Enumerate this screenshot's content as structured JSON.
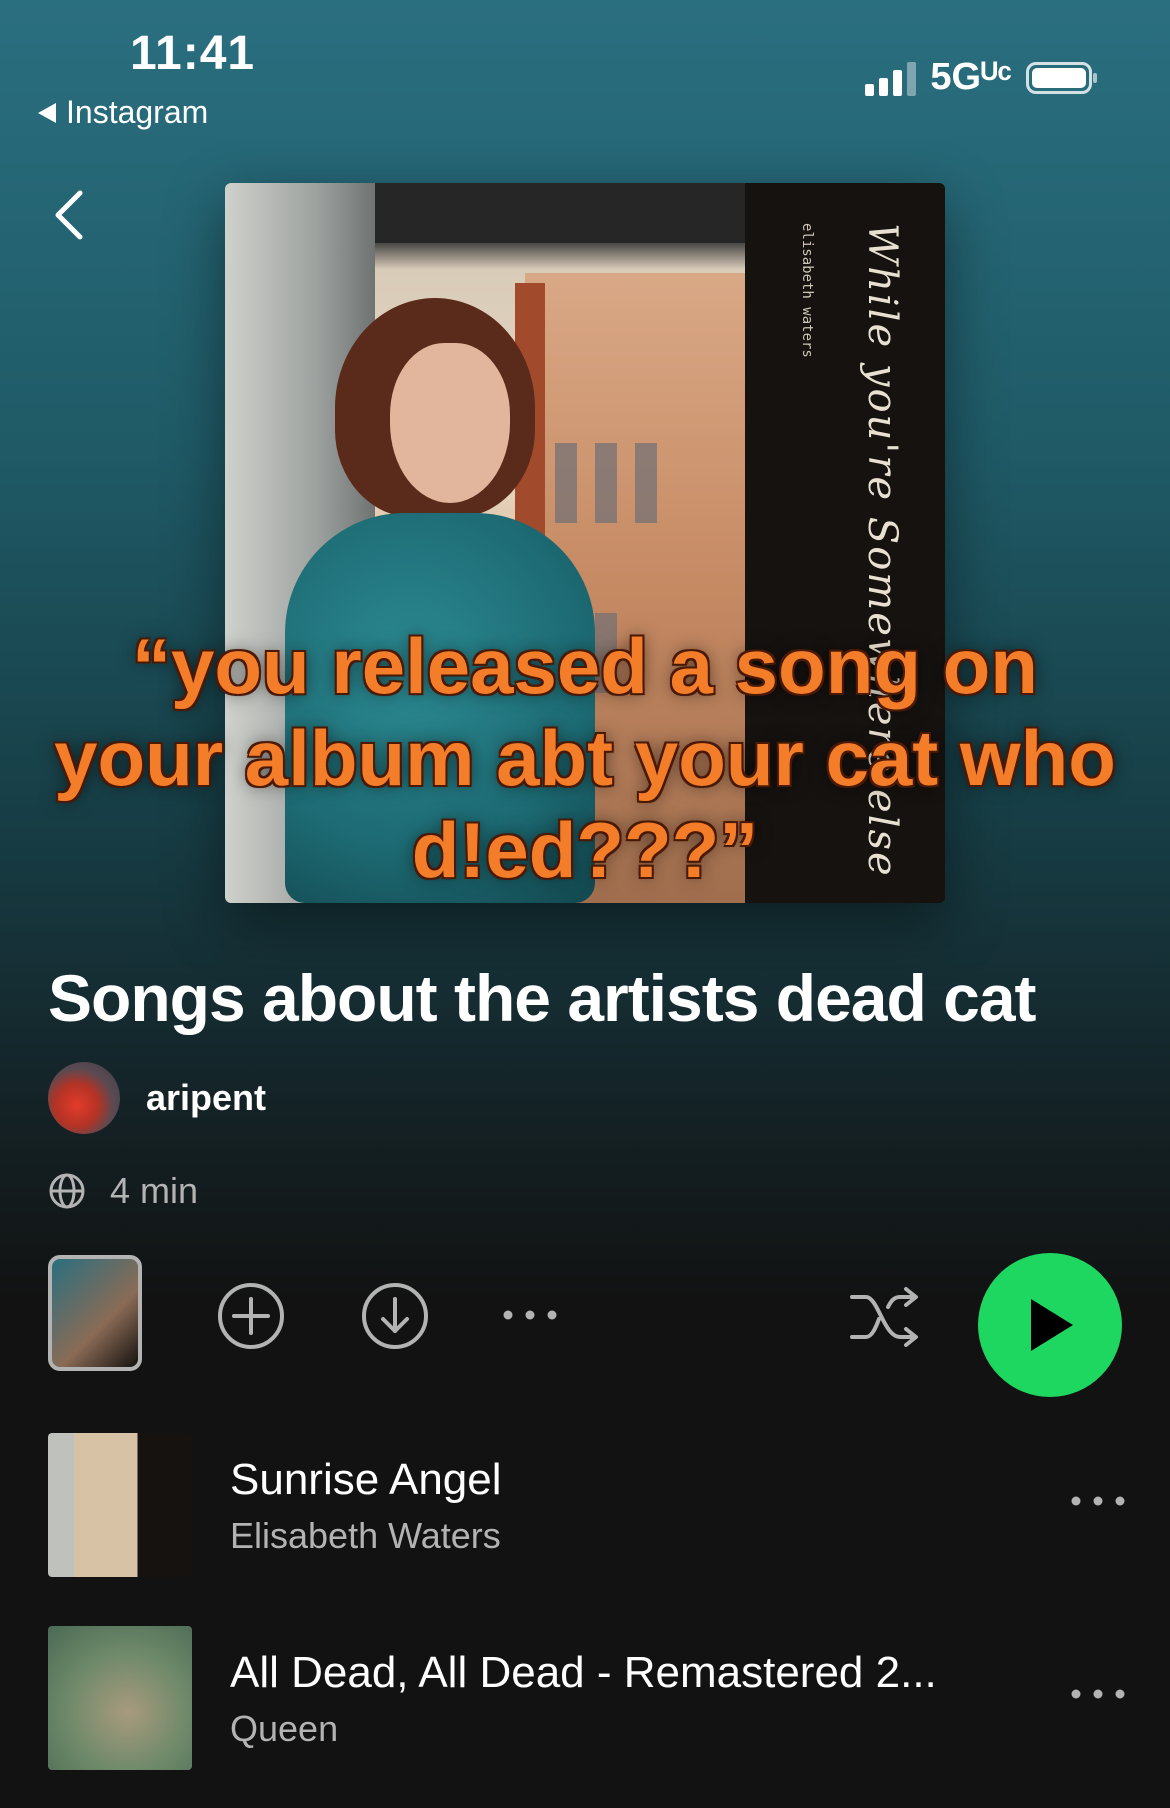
{
  "status_bar": {
    "time": "11:41",
    "back_app": "Instagram",
    "network": "5Gᵁᶜ"
  },
  "cover": {
    "script_text": "While you're Somewhere else",
    "artist_text": "elisabeth waters"
  },
  "overlay_caption": "“you released a song on your album abt your cat who d!ed???”",
  "playlist": {
    "title": "Songs about the artists dead cat",
    "owner": "aripent",
    "duration": "4 min"
  },
  "tracks": [
    {
      "name": "Sunrise Angel",
      "artist": "Elisabeth Waters"
    },
    {
      "name": "All Dead, All Dead - Remastered 2...",
      "artist": "Queen"
    }
  ],
  "colors": {
    "accent_green": "#1ed760",
    "caption_orange": "#f47d2a",
    "background": "#121212",
    "gradient_top": "#2a6f80"
  }
}
